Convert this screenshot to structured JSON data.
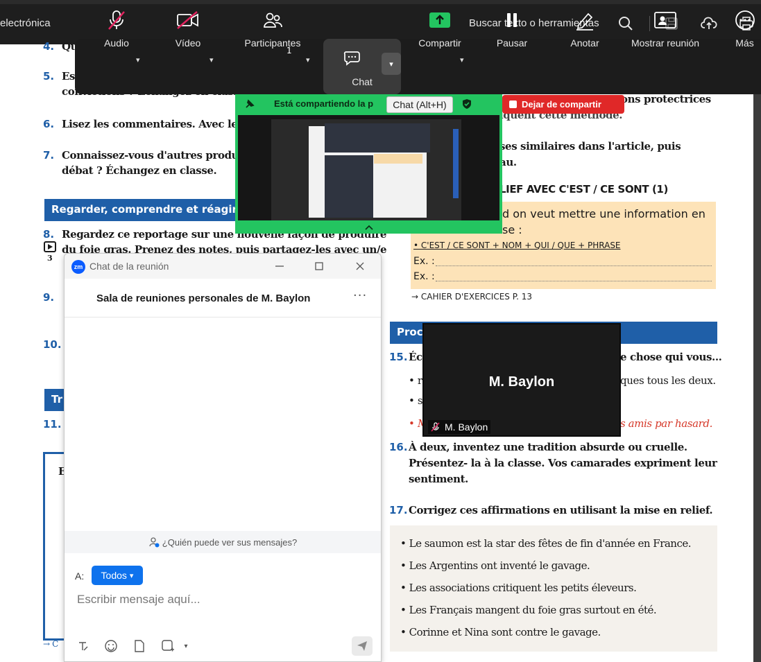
{
  "pdf_viewer": {
    "title_fragment": "electrónica",
    "search_label": "Buscar texto o herramientas"
  },
  "zoom_toolbar": {
    "audio": "Audio",
    "video": "Vídeo",
    "participants": "Participantes",
    "participants_count": "1",
    "chat": "Chat",
    "share": "Compartir",
    "pause": "Pausar",
    "annotate": "Anotar",
    "show_meeting": "Mostrar reunión",
    "more": "Más"
  },
  "share_banner": {
    "text": "Está compartiendo la p",
    "tooltip": "Chat (Alt+H)",
    "stop_label": "Dejar de compartir"
  },
  "chat_window": {
    "title": "Chat de la reunión",
    "logo": "zm",
    "room_name": "Sala de reuniones personales de M. Baylon",
    "more": "···",
    "who_can_see": "¿Quién puede ver sus mensajes?",
    "to_label": "A:",
    "to_value": "Todos",
    "placeholder": "Escribir mensaje aquí..."
  },
  "video_tile": {
    "name": "M. Baylon",
    "tag": "M. Baylon"
  },
  "document": {
    "left": {
      "q4_num": "4.",
      "q4_text": "Qu",
      "q5_num": "5.",
      "q5_line1": "Es",
      "q5_line2": "convictions ? Échangez en classe",
      "q6_num": "6.",
      "q6_text": "Lisez les commentaires. Avec leq",
      "q7_num": "7.",
      "q7_line1": "Connaissez-vous d'autres produit",
      "q7_line2": "débat ? Échangez en classe.",
      "section_watch": "Regarder, comprendre et réagir",
      "q8_num": "8.",
      "q8_line1": "Regardez ce reportage sur une nouvelle façon de produire",
      "q8_line2": "du foie gras. Prenez des notes, puis partagez-les avec un/e",
      "video_index": "3",
      "q9_num": "9.",
      "q10_num": "10.",
      "section_tr": "Tr",
      "q11_num": "11.",
      "e_label": "E",
      "footer_arrow": "→ C"
    },
    "right": {
      "top_line": "ons protectrices",
      "top_line2": "iquent cette méthode.",
      "sim_line1": "ses similaires dans l'article, puis",
      "sim_line2": "au.",
      "grammar_title": "LIEF AVEC C'EST / CE SONT (1)",
      "grammar_line1": "d on veut mettre une information en",
      "grammar_line2": "se :",
      "grammar_rule": "• C'EST / CE SONT + NOM + QUI / QUE + PHRASE",
      "ex1": "Ex. :",
      "ex2": "Ex. :",
      "cahier": "→ CAHIER D'EXERCICES  P. 13",
      "section_prod": "Proc",
      "q15_num": "15.",
      "q15_start": "Éc",
      "q15_end": "e chose qui vous...",
      "b1_start": "• r",
      "b1_end": "ques tous les deux.",
      "b2_start": "• s",
      "b3_start": "• M",
      "b3_end": "s amis par hasard.",
      "q16_num": "16.",
      "q16_line1": "À deux, inventez une tradition absurde ou cruelle.",
      "q16_line2": "Présentez- la à la classe. Vos camarades expriment leur",
      "q16_line3": "sentiment.",
      "q17_num": "17.",
      "q17_text": "Corrigez ces affirmations en utilisant la mise en relief.",
      "bullets": [
        "Le saumon est la star des fêtes de fin d'année en France.",
        "Les Argentins ont inventé le gavage.",
        "Les associations critiquent les petits éleveurs.",
        "Les Français mangent du foie gras surtout en été.",
        "Corinne et Nina sont contre le gavage."
      ]
    }
  },
  "colors": {
    "accent_blue": "#1f5fa8",
    "zoom_green": "#23c460",
    "stop_red": "#e02828",
    "zoom_blue": "#0e72ed"
  }
}
